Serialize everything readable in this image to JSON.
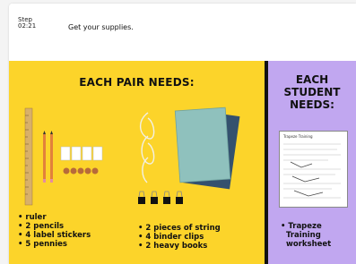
{
  "header": {
    "step_label": "Step",
    "step_time": "02:21",
    "title": "Get your supplies."
  },
  "pair_panel": {
    "title": "EACH PAIR NEEDS:",
    "left_list": [
      "• ruler",
      "• 2 pencils",
      "• 4 label stickers",
      "• 5 pennies"
    ],
    "mid_list": [
      "• 2 pieces of string",
      "• 4 binder clips",
      "• 2 heavy books"
    ],
    "background": "#fcd42a"
  },
  "student_panel": {
    "title_lines": [
      "EACH",
      "STUDENT",
      "NEEDS:"
    ],
    "list": [
      "• Trapeze",
      "Training",
      "worksheet"
    ],
    "worksheet_title": "Trapeze Training",
    "background": "#c1a7f0"
  }
}
